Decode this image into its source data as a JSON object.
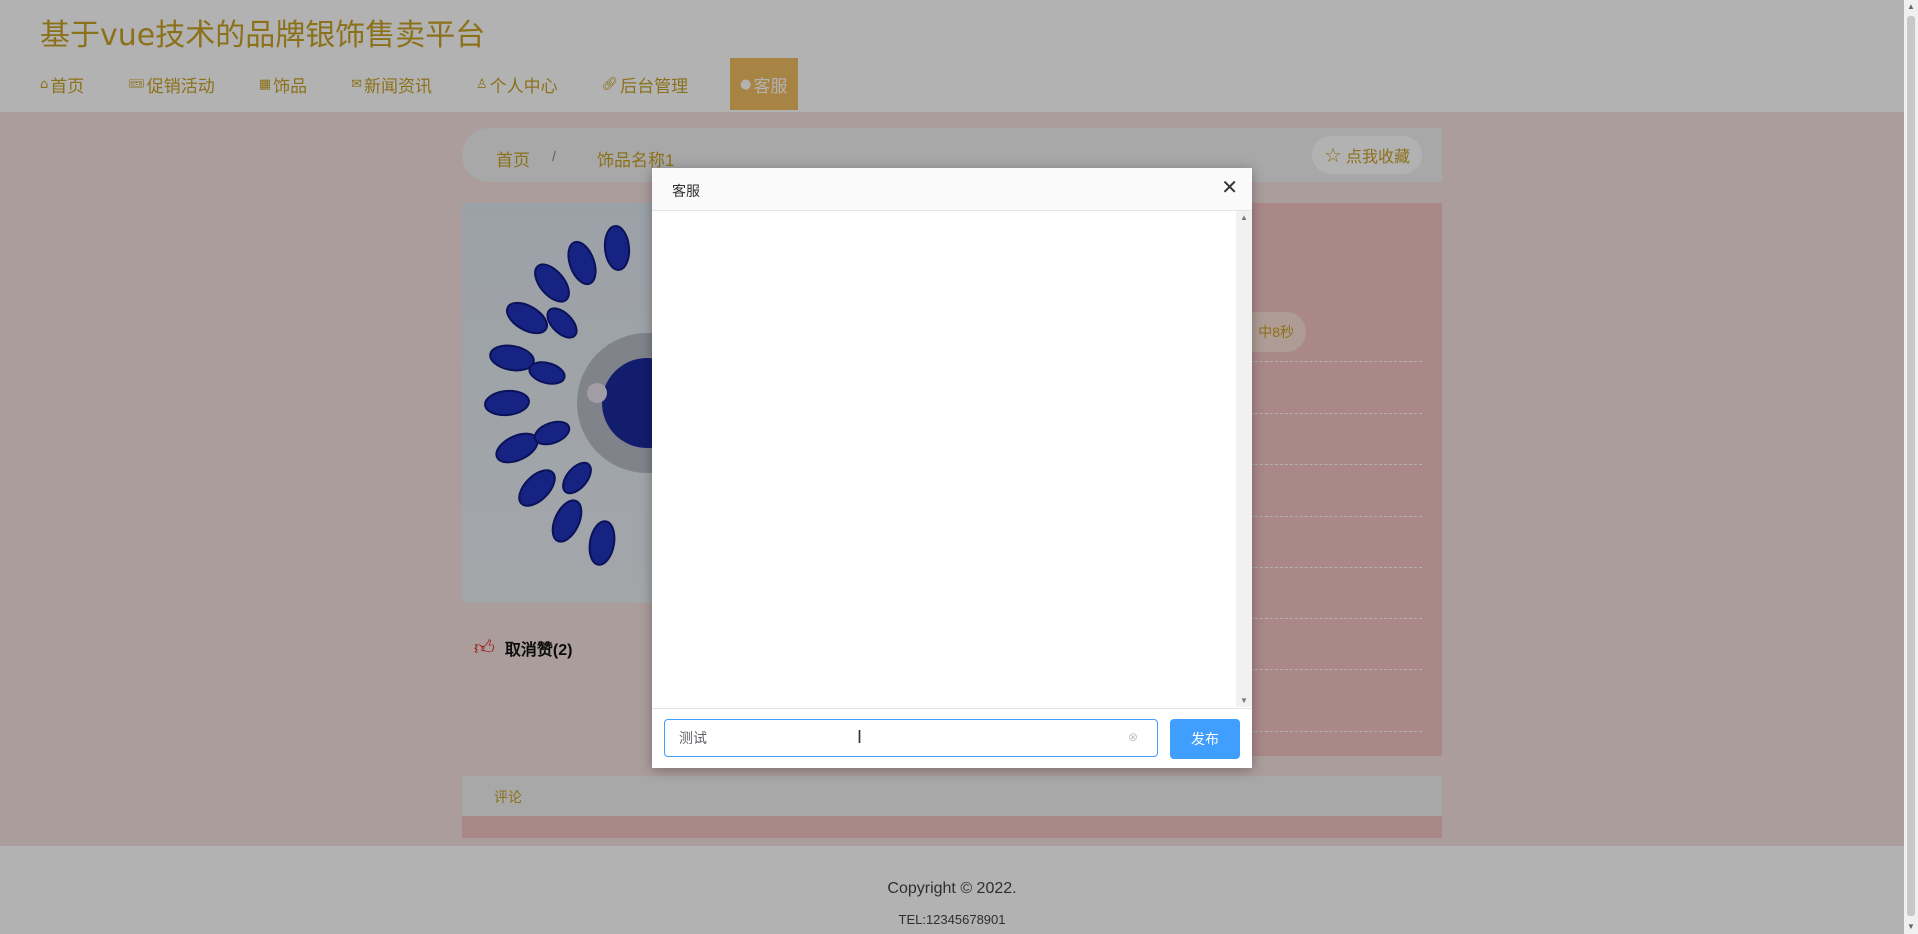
{
  "site_title": "基于vue技术的品牌银饰售卖平台",
  "nav": [
    {
      "label": "首页",
      "icon": "home-icon"
    },
    {
      "label": "促销活动",
      "icon": "ticket-icon"
    },
    {
      "label": "饰品",
      "icon": "gift-icon"
    },
    {
      "label": "新闻资讯",
      "icon": "mail-icon"
    },
    {
      "label": "个人中心",
      "icon": "user-icon"
    },
    {
      "label": "后台管理",
      "icon": "link-icon"
    },
    {
      "label": "客服",
      "icon": "chat-icon",
      "active": true
    }
  ],
  "breadcrumb": {
    "home": "首页",
    "separator": "/",
    "current": "饰品名称1"
  },
  "favorite_label": "点我收藏",
  "countdown_partial": "中8秒",
  "like_label": "取消赞(2)",
  "comment_tab": "评论",
  "footer": {
    "copyright": "Copyright © 2022.",
    "tel": "TEL:12345678901"
  },
  "dialog": {
    "title": "客服",
    "input_value": "测试",
    "send_label": "发布"
  },
  "colors": {
    "accent": "#c9a227",
    "primary_button": "#409eff",
    "panel_pink": "#f5c3c3"
  }
}
